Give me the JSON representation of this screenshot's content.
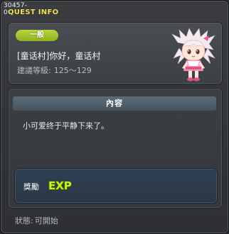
{
  "window": {
    "quest_id": "30457-0",
    "title": "QUEST INFO"
  },
  "quest": {
    "category": "一般",
    "name": "[童话村]你好，童话村",
    "level_label": "建議等級:",
    "level_range": "125〜129"
  },
  "content": {
    "header": "內容",
    "description": "小可爱终于平静下来了。"
  },
  "reward": {
    "label": "獎勵",
    "exp_text": "EXP"
  },
  "status": {
    "label": "狀態:",
    "value": "可開始"
  },
  "colors": {
    "title": "#f4e35a",
    "badge": "#9cc22a",
    "exp": "#c7f21d"
  },
  "icons": [
    "npc-girl-portrait",
    "exp-icon"
  ]
}
